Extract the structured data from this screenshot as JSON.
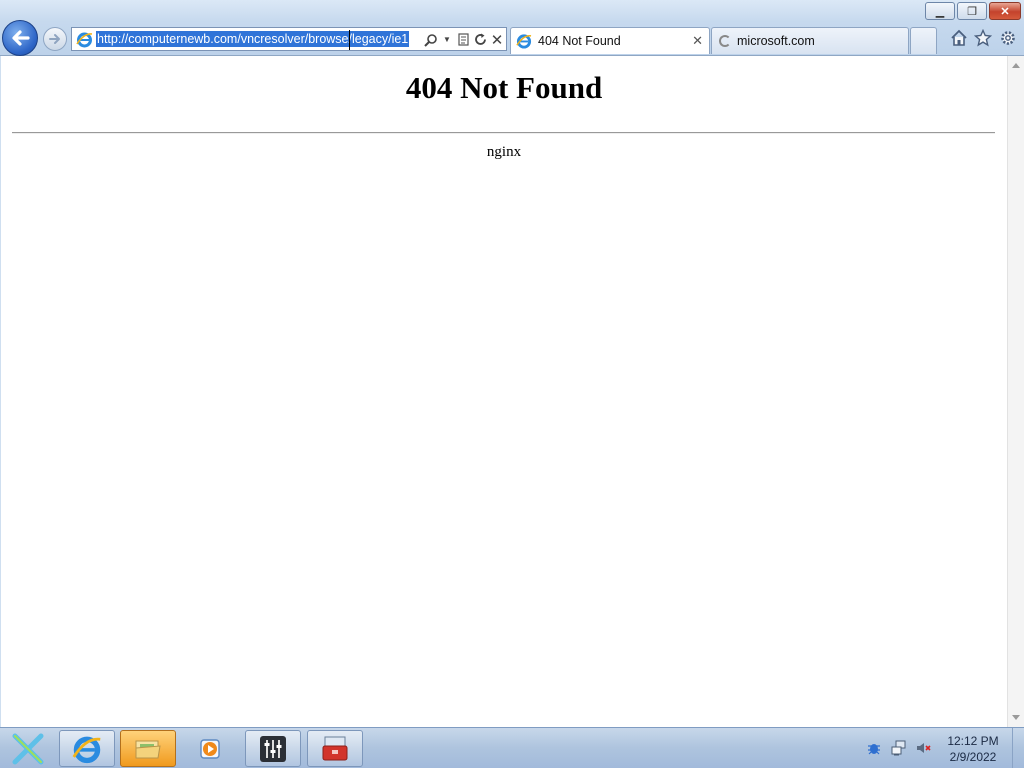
{
  "window": {
    "minimize_glyph": "▁",
    "maximize_glyph": "❐",
    "close_glyph": "✕"
  },
  "address_bar": {
    "url": "http://computernewb.com/vncresolver/browse/legacy/ie1"
  },
  "tabs": [
    {
      "label": "404 Not Found",
      "active": true,
      "close_glyph": "✕"
    },
    {
      "label": "microsoft.com",
      "active": false,
      "loading": true
    }
  ],
  "page": {
    "heading": "404 Not Found",
    "server": "nginx"
  },
  "taskbar": {
    "items": [
      "internet-explorer",
      "windows-explorer",
      "windows-media-player",
      "volume-mixer",
      "toolbox"
    ]
  },
  "clock": {
    "time": "12:12 PM",
    "date": "2/9/2022"
  },
  "colors": {
    "selection": "#3074d8",
    "close_button": "#c4432c"
  }
}
